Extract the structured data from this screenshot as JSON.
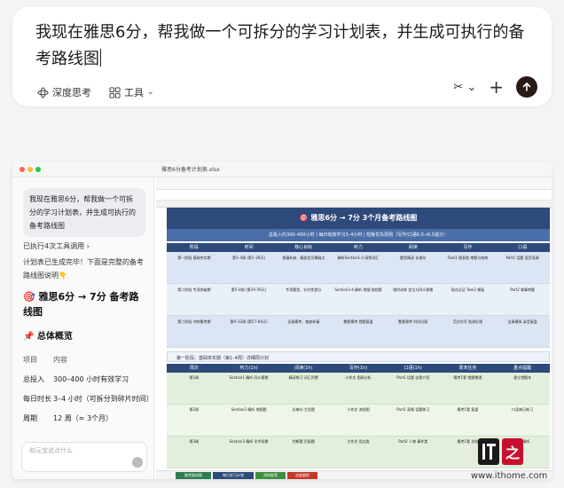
{
  "prompt": {
    "text": "我现在雅思6分，帮我做一个可拆分的学习计划表，并生成可执行的备考路线图",
    "deep_think": "深度思考",
    "tools": "工具"
  },
  "app": {
    "window_title": "雅思6分备考计划表.xlsx",
    "left_pane": {
      "bubble": "我现在雅思6分，帮我做一个可拆分的学习计划表，并生成可执行的备考路线图",
      "tool_note": "已执行4次工具调用 ›",
      "desc": "计划表已生成完毕！下面是完整的备考路线图说明👇",
      "heading": "🎯 雅思6分 → 7分 备考路线图",
      "overview_title": "📌 总体概览",
      "overview_header": [
        "项目",
        "内容"
      ],
      "overview_rows": [
        [
          "总投入",
          "300–400 小时有效学习"
        ],
        [
          "每日时长",
          "3–4 小时（可拆分到碎片时间）"
        ],
        [
          "周期",
          "12 周（≈ 3个月）"
        ]
      ],
      "input_placeholder": "和元宝说点什么"
    },
    "sheet": {
      "banner": "🎯 雅思6分 → 7分 3个月备考路线图",
      "sub_banner": "总投入约300–400小时 | 每日有效学习3–4小时 | 短板优先原则（写作/口语6.0→6.5提分）",
      "columns": [
        "阶段",
        "时间",
        "核心目标",
        "听力",
        "阅读",
        "写作",
        "口语"
      ],
      "phases": [
        [
          "第一阶段 基础夯实期",
          "第1–4周 (第1–28天)",
          "查漏补缺、精准定位薄弱点",
          "精听Section1-2 高频词汇",
          "题型精读 长难句",
          "Task1 图表类 审题与结构",
          "Part1 话题 语音语调"
        ],
        [
          "第二阶段 专项突破期",
          "第5–8周 (第29–56天)",
          "专项题型、针对性提分",
          "Section3-4 精听 地图/流程题",
          "限时训练 定位与同义替换",
          "观点论证 Task2 模板",
          "Part2 故事串题"
        ],
        [
          "第三阶段 冲刺模考期",
          "第9–12周 (第57–84天)",
          "全真模考、查缺补漏",
          "整套模考 错题复盘",
          "整套模考 时间分配",
          "范文仿写 批改反馈",
          "全真模拟 录音复盘"
        ]
      ],
      "section_title": "第一阶段：基础夯实期（第1–4周）详细周计划",
      "week_columns": [
        "周次",
        "听力(1h)",
        "阅读(1h)",
        "写作(1h)",
        "口语(1h)",
        "周末任务",
        "重点提醒"
      ],
      "weeks": [
        [
          "第1周",
          "Section1 精听 同义替换",
          "精读练习 词汇积累",
          "小作文 图表分析",
          "Part1 话题 自我介绍",
          "模考1套 错题整理",
          "建立错题本"
        ],
        [
          "第2周",
          "Section2 精听 地图题",
          "长难句 主旨题",
          "小作文 流程图",
          "Part1 高频 话题练习",
          "模考1套 复盘",
          "口语每日练习"
        ],
        [
          "第3周",
          "Section3 精听 学术场景",
          "判断题 匹配题",
          "大作文 观点类",
          "Part2 人物 事件类",
          "模考1套 总结",
          "坚持精听"
        ]
      ],
      "tabs": [
        "备考路线图",
        "每日学习计划",
        "资料推荐",
        "进度跟踪"
      ]
    }
  },
  "watermark": {
    "logo_text": "IT之家",
    "site": "www.ithome.com"
  },
  "colors": {
    "banner": "#2e4a7a",
    "subbanner": "#4a6ea8",
    "phase_bg": "#dbe5f3",
    "week_bg": "#e3efdc",
    "logo": "#c8102e"
  }
}
